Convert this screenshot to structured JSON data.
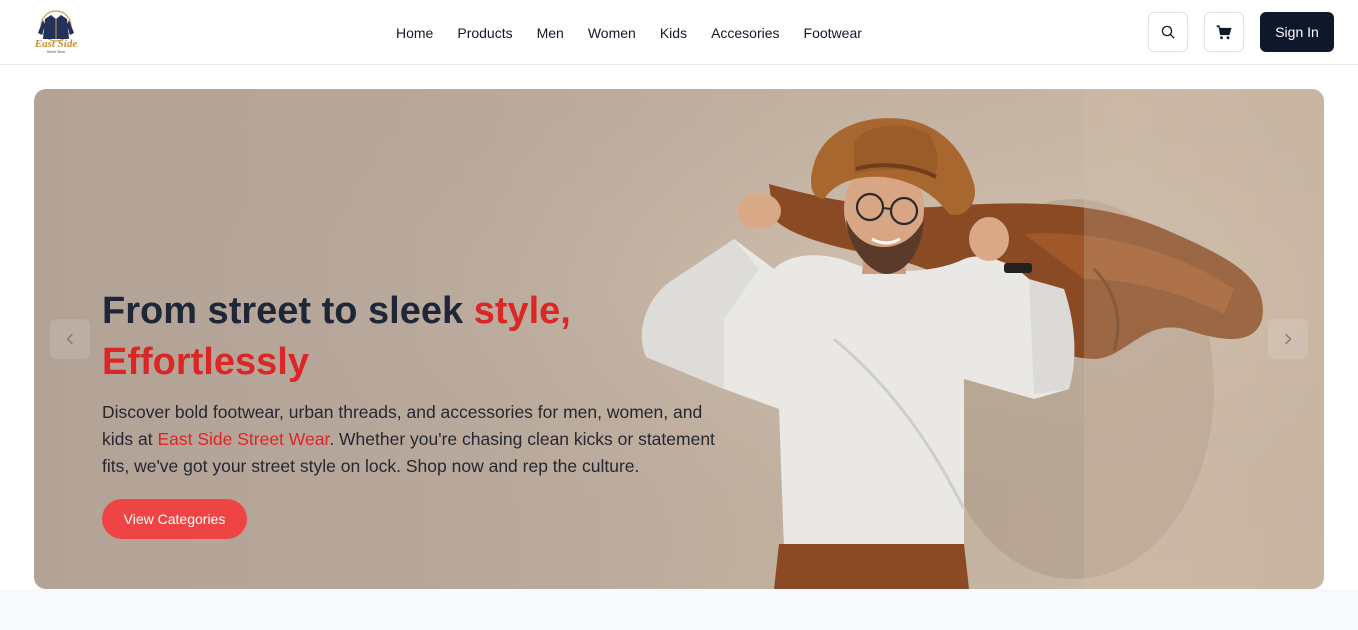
{
  "brand": {
    "logo_text": "East Side",
    "logo_subtext": "Street Wear"
  },
  "nav": {
    "items": [
      {
        "label": "Home"
      },
      {
        "label": "Products"
      },
      {
        "label": "Men"
      },
      {
        "label": "Women"
      },
      {
        "label": "Kids"
      },
      {
        "label": "Accesories"
      },
      {
        "label": "Footwear"
      }
    ]
  },
  "header": {
    "search_icon": "search-icon",
    "cart_icon": "cart-icon",
    "signin_label": "Sign In"
  },
  "hero": {
    "title_part1": "From street to sleek ",
    "title_accent": "style, Effortlessly",
    "desc_part1": "Discover bold footwear, urban threads, and accessories for men, women, and kids at ",
    "desc_accent": "East Side Street Wear",
    "desc_part2": ". Whether you're chasing clean kicks or statement fits, we've got your street style on lock. Shop now and rep the culture.",
    "cta_label": "View Categories",
    "prev_icon": "chevron-left-icon",
    "next_icon": "chevron-right-icon"
  },
  "colors": {
    "accent": "#dc2626",
    "cta": "#ef4444",
    "signin_bg": "#0f172a",
    "hero_bg": "#b8a89b"
  }
}
